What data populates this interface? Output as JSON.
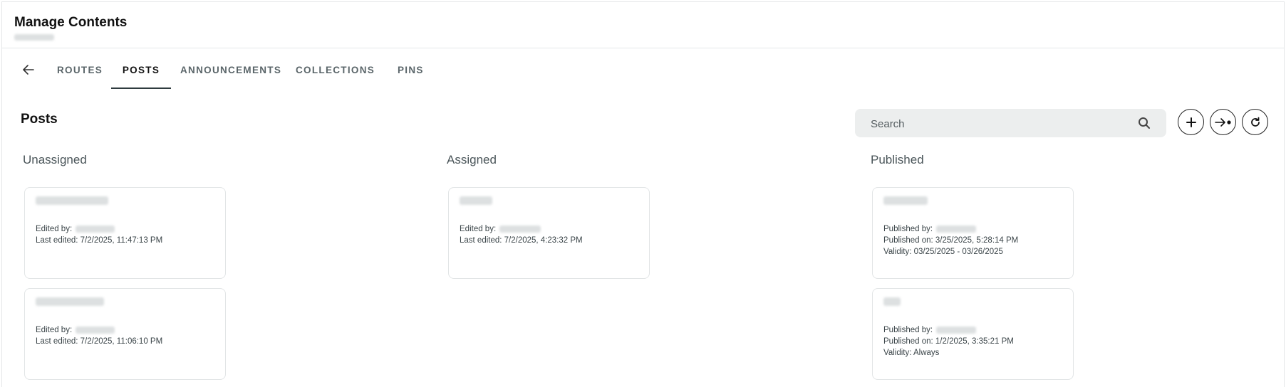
{
  "header": {
    "title": "Manage Contents"
  },
  "tabs": [
    {
      "label": "ROUTES"
    },
    {
      "label": "POSTS"
    },
    {
      "label": "ANNOUNCEMENTS"
    },
    {
      "label": "COLLECTIONS"
    },
    {
      "label": "PINS"
    }
  ],
  "active_tab": "POSTS",
  "section": {
    "title": "Posts"
  },
  "search": {
    "placeholder": "Search"
  },
  "toolbar": {
    "icons": [
      "plus-icon",
      "arrow-right-dot-icon",
      "refresh-icon"
    ]
  },
  "columns": {
    "unassigned": {
      "title": "Unassigned",
      "cards": [
        {
          "edited_label": "Edited by:",
          "last_edited": "Last edited: 7/2/2025, 11:47:13 PM"
        },
        {
          "edited_label": "Edited by:",
          "last_edited": "Last edited: 7/2/2025, 11:06:10 PM"
        }
      ]
    },
    "assigned": {
      "title": "Assigned",
      "cards": [
        {
          "edited_label": "Edited by:",
          "last_edited": "Last edited: 7/2/2025, 4:23:32 PM"
        }
      ]
    },
    "published": {
      "title": "Published",
      "cards": [
        {
          "published_label": "Published by:",
          "published_on": "Published on: 3/25/2025, 5:28:14 PM",
          "validity": "Validity: 03/25/2025 - 03/26/2025"
        },
        {
          "published_label": "Published by:",
          "published_on": "Published on: 1/2/2025, 3:35:21 PM",
          "validity": "Validity: Always"
        }
      ]
    }
  },
  "colors": {
    "active_tab_underline": "#2f3b3f",
    "search_bg": "#eceeee",
    "card_border": "#e2e5e6"
  }
}
